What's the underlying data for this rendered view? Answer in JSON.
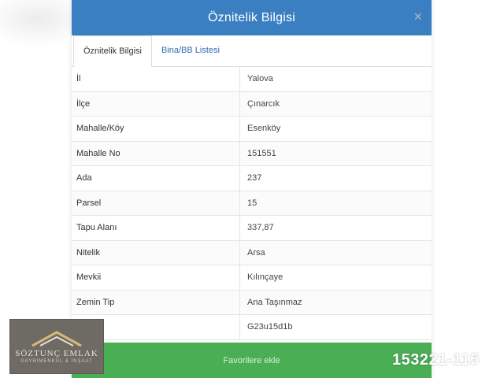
{
  "modal": {
    "title": "Öznitelik Bilgisi",
    "close_label": "×",
    "tabs": [
      {
        "label": "Öznitelik Bilgisi",
        "active": true
      },
      {
        "label": "Bina/BB Listesi",
        "active": false
      }
    ],
    "rows": [
      {
        "key": "İl",
        "value": "Yalova"
      },
      {
        "key": "İlçe",
        "value": "Çınarcık"
      },
      {
        "key": "Mahalle/Köy",
        "value": "Esenköy"
      },
      {
        "key": "Mahalle No",
        "value": "151551"
      },
      {
        "key": "Ada",
        "value": "237"
      },
      {
        "key": "Parsel",
        "value": "15"
      },
      {
        "key": "Tapu Alanı",
        "value": "337,87"
      },
      {
        "key": "Nitelik",
        "value": "Arsa"
      },
      {
        "key": "Mevkii",
        "value": "Kılınçaye"
      },
      {
        "key": "Zemin Tip",
        "value": "Ana Taşınmaz"
      },
      {
        "key": "",
        "value": "G23u15d1b"
      }
    ],
    "footer_button_label": "Favorilere ekle",
    "header_color": "#3a7fc1",
    "footer_color": "#4aae55"
  },
  "logo": {
    "name": "SÖZTUNÇ EMLAK",
    "subtitle": "GAYRİMENKUL & İNŞAAT"
  },
  "listing_id": "153221-115"
}
